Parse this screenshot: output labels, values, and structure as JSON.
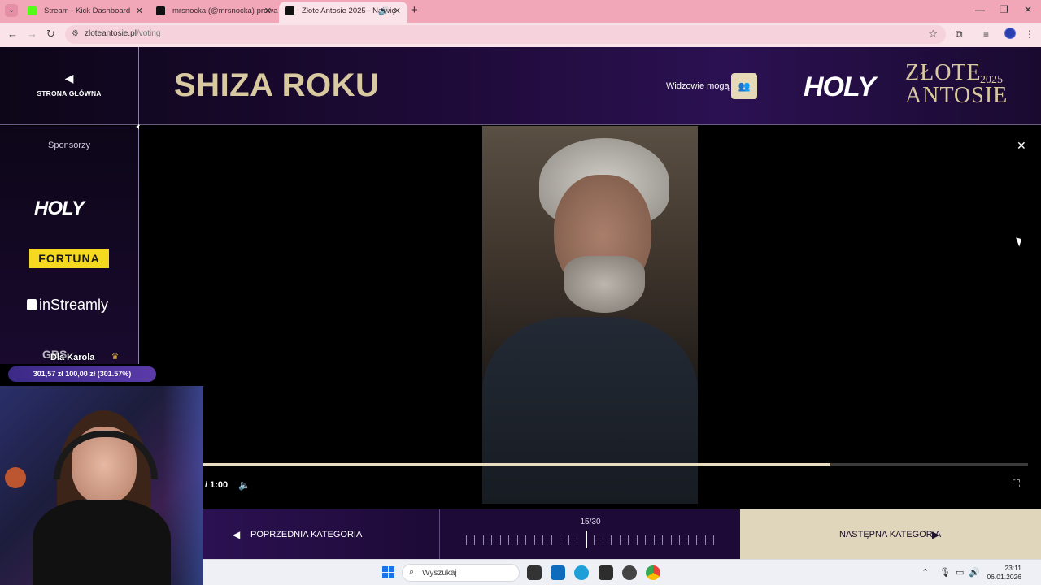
{
  "browser": {
    "tabs": [
      {
        "title": "Stream - Kick Dashboard",
        "favicon_color": "#53fc18",
        "active": false
      },
      {
        "title": "mrsnocka (@mrsnocka) prowa",
        "favicon_color": "#111111",
        "active": false
      },
      {
        "title": "Złote Antosie 2025 - Najwię",
        "favicon_color": "#111111",
        "active": true
      }
    ],
    "url_host": "zloteantosie.pl",
    "url_path": "/voting"
  },
  "header": {
    "home_label": "STRONA GŁÓWNA",
    "category_title": "SHIZA ROKU",
    "viewers_label": "Widzowie mogą",
    "brand_logo": "HOLY",
    "award_line1": "ZŁOTE",
    "award_year": "2025",
    "award_line2": "ANTOSIE"
  },
  "sidebar": {
    "sponsors_title": "Sponsorzy",
    "sponsors": [
      "HOLY",
      "FORTUNA",
      "inStreamly",
      "GBS"
    ]
  },
  "player": {
    "time": "/ 1:00",
    "progress": 0.76
  },
  "navigation": {
    "prev_label": "POPRZEDNIA KATEGORIA",
    "next_label": "NASTĘPNA KATEGORIA",
    "counter": "15/30",
    "current": 15,
    "total": 30
  },
  "donation": {
    "title": "Dla Karola",
    "progress_text": "301,57 zł   100,00 zł (301.57%)"
  },
  "taskbar": {
    "search_placeholder": "Wyszukaj",
    "time": "23:11",
    "date": "06.01.2026"
  },
  "colors": {
    "accent_gold": "#d9c9a1",
    "header_purple": "#2b1152",
    "fortuna_yellow": "#f5d820"
  }
}
